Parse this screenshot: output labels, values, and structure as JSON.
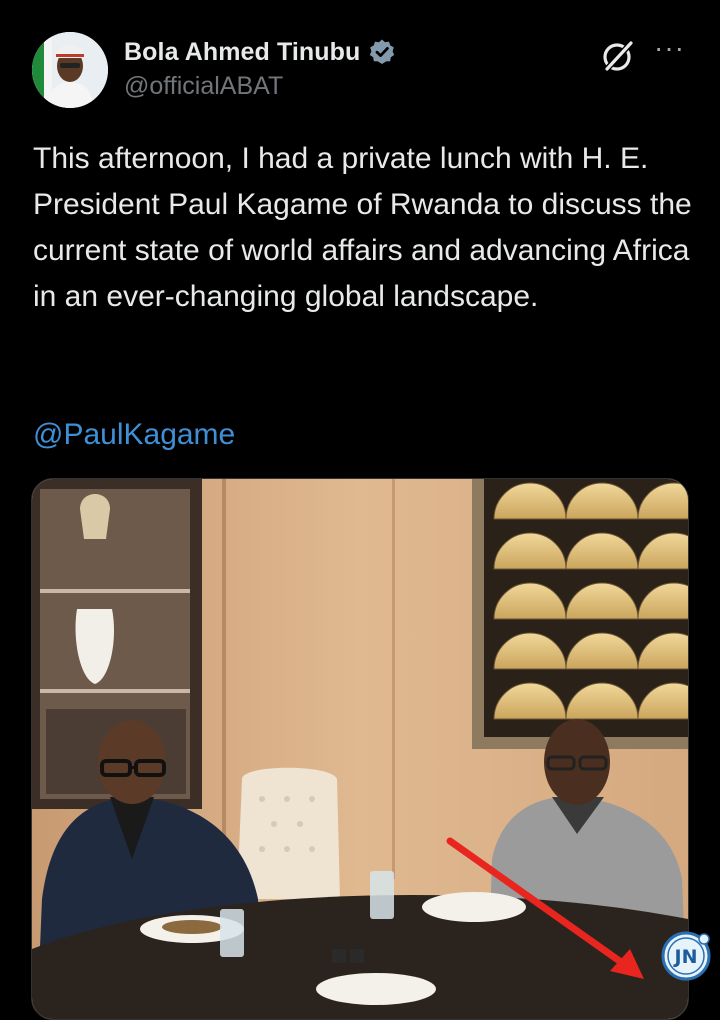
{
  "tweet": {
    "author": {
      "display_name": "Bola Ahmed Tinubu",
      "handle": "@officialABAT",
      "verified": true,
      "avatar_icon": "profile-photo"
    },
    "text": "This afternoon, I had a private lunch with H. E. President Paul Kagame of Rwanda to discuss the current state of world affairs and advancing Africa in an ever-changing global landscape.",
    "mention": "@PaulKagame",
    "media": {
      "type": "photo",
      "description_icon": "photo"
    },
    "actions": {
      "grok_icon": "grok-icon",
      "more_icon": "more-options-icon",
      "more_symbol": "···"
    }
  },
  "watermark": {
    "label": "JN"
  },
  "colors": {
    "background": "#000000",
    "text_primary": "#e7e9ea",
    "text_secondary": "#71767b",
    "link": "#3f8fd6",
    "verified_badge": "#829aab",
    "arrow": "#e8261f"
  }
}
